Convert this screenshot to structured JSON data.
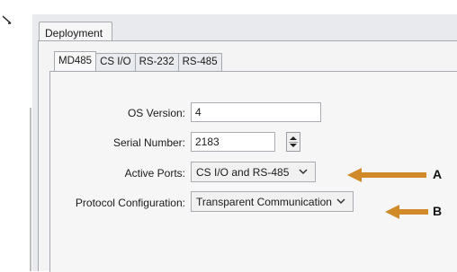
{
  "outer_tab": {
    "label": "Deployment"
  },
  "inner_tabs": [
    "MD485",
    "CS I/O",
    "RS-232",
    "RS-485"
  ],
  "fields": {
    "os_version": {
      "label": "OS Version:",
      "value": "4"
    },
    "serial_number": {
      "label": "Serial Number:",
      "value": "2183"
    },
    "active_ports": {
      "label": "Active Ports:",
      "value": "CS I/O and RS-485"
    },
    "protocol_configuration": {
      "label": "Protocol Configuration:",
      "value": "Transparent Communication"
    }
  },
  "callouts": {
    "a": "A",
    "b": "B"
  },
  "colors": {
    "arrow": "#d08a2a"
  },
  "icons": {
    "spinner": "spin-updown-icon",
    "dropdown": "chevron-down-icon",
    "arrow": "left-arrow-icon"
  }
}
